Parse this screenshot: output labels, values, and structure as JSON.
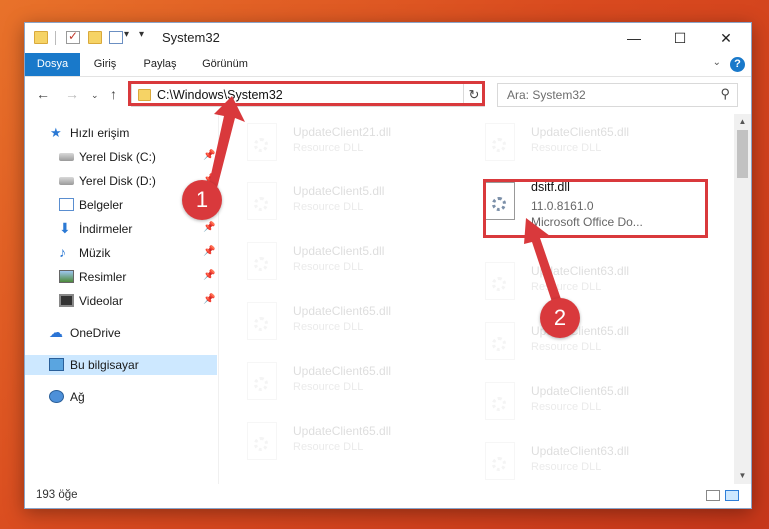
{
  "window": {
    "title": "System32",
    "minimize_glyph": "—",
    "maximize_glyph": "☐",
    "close_glyph": "✕"
  },
  "ribbon": {
    "tabs": [
      "Dosya",
      "Giriş",
      "Paylaş",
      "Görünüm"
    ],
    "active_tab": "Dosya",
    "help_glyph": "?"
  },
  "address_bar": {
    "path": "C:\\Windows\\System32"
  },
  "search": {
    "placeholder": "Ara: System32"
  },
  "sidebar": {
    "items": [
      {
        "label": "Hızlı erişim",
        "icon": "star-icon"
      },
      {
        "label": "Yerel Disk (C:)",
        "icon": "drive-icon",
        "pinned": true
      },
      {
        "label": "Yerel Disk (D:)",
        "icon": "drive-icon",
        "pinned": true
      },
      {
        "label": "Belgeler",
        "icon": "documents-icon",
        "pinned": true
      },
      {
        "label": "İndirmeler",
        "icon": "downloads-icon",
        "pinned": true
      },
      {
        "label": "Müzik",
        "icon": "music-icon",
        "pinned": true
      },
      {
        "label": "Resimler",
        "icon": "pictures-icon",
        "pinned": true
      },
      {
        "label": "Videolar",
        "icon": "videos-icon",
        "pinned": true
      },
      {
        "label": "OneDrive",
        "icon": "cloud-icon"
      },
      {
        "label": "Bu bilgisayar",
        "icon": "computer-icon",
        "selected": true
      },
      {
        "label": "Ağ",
        "icon": "network-icon"
      }
    ]
  },
  "files": {
    "left_column": [
      {
        "name": "UpdateClient21.dll",
        "desc": "Resource DLL"
      },
      {
        "name": "UpdateClient5.dll",
        "desc": "Resource DLL"
      },
      {
        "name": "UpdateClient5.dll",
        "desc": "Resource DLL"
      },
      {
        "name": "UpdateClient65.dll",
        "desc": "Resource DLL"
      },
      {
        "name": "UpdateClient65.dll",
        "desc": "Resource DLL"
      },
      {
        "name": "UpdateClient65.dll",
        "desc": "Resource DLL"
      }
    ],
    "right_column": [
      {
        "name": "UpdateClient65.dll",
        "desc": "Resource DLL"
      },
      {
        "name": "UpdateClient63.dll",
        "desc": "Resource DLL"
      },
      {
        "name": "UpdateClient65.dll",
        "desc": "Resource DLL"
      },
      {
        "name": "UpdateClient65.dll",
        "desc": "Resource DLL"
      },
      {
        "name": "UpdateClient63.dll",
        "desc": "Resource DLL"
      }
    ],
    "highlighted": {
      "name": "dsitf.dll",
      "version": "11.0.8161.0",
      "desc": "Microsoft Office Do..."
    }
  },
  "status": {
    "item_count": "193 öğe"
  },
  "annotations": {
    "step1": "1",
    "step2": "2",
    "color": "#d9393c"
  }
}
